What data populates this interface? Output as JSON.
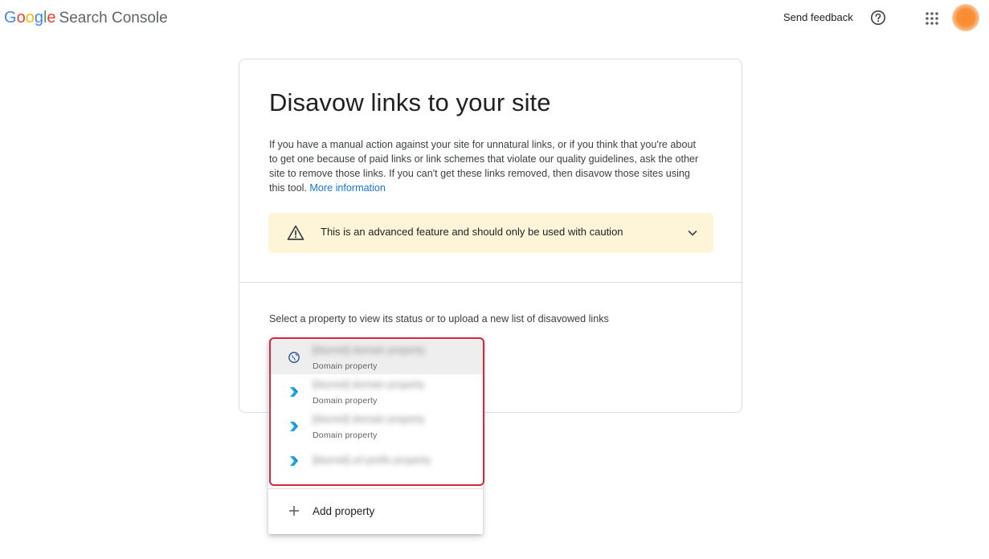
{
  "header": {
    "logo": {
      "letters": [
        {
          "char": "G",
          "color": "#4285f4"
        },
        {
          "char": "o",
          "color": "#ea4335"
        },
        {
          "char": "o",
          "color": "#fbbc05"
        },
        {
          "char": "g",
          "color": "#4285f4"
        },
        {
          "char": "l",
          "color": "#34a853"
        },
        {
          "char": "e",
          "color": "#ea4335"
        }
      ],
      "product": "Search Console"
    },
    "send_feedback": "Send feedback",
    "help_icon": "help-circle-icon",
    "apps_icon": "apps-grid-icon"
  },
  "card": {
    "title": "Disavow links to your site",
    "description": "If you have a manual action against your site for unnatural links, or if you think that you're about to get one because of paid links or link schemes that violate our quality guidelines, ask the other site to remove those links. If you can't get these links removed, then disavow those sites using this tool.",
    "more_link": "More information",
    "warning": {
      "text": "This is an advanced feature and should only be used with caution",
      "background": "#fef4d7"
    },
    "select_label": "Select a property to view its status or to upload a new list of disavowed links"
  },
  "dropdown": {
    "items": [
      {
        "name": "[blurred] domain property",
        "type": "Domain property",
        "icon": "globe-icon",
        "selected": true
      },
      {
        "name": "[blurred] domain property",
        "type": "Domain property",
        "icon": "url-prefix-chevron-icon",
        "selected": false
      },
      {
        "name": "[blurred] domain property",
        "type": "Domain property",
        "icon": "url-prefix-chevron-icon",
        "selected": false
      },
      {
        "name": "[blurred] url-prefix property",
        "type": "",
        "icon": "url-prefix-chevron-icon",
        "selected": false
      }
    ],
    "add_property": "Add property",
    "highlight_color": "#d7263d"
  }
}
